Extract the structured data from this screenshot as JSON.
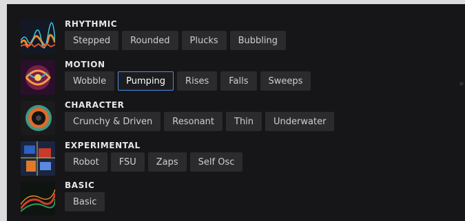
{
  "categories": [
    {
      "title": "RHYTHMIC",
      "thumb_icon": "rhythmic-waveform-thumbnail",
      "tags": [
        "Stepped",
        "Rounded",
        "Plucks",
        "Bubbling"
      ],
      "selected": null
    },
    {
      "title": "MOTION",
      "thumb_icon": "motion-swirl-thumbnail",
      "tags": [
        "Wobble",
        "Pumping",
        "Rises",
        "Falls",
        "Sweeps"
      ],
      "selected": 1
    },
    {
      "title": "CHARACTER",
      "thumb_icon": "character-speaker-thumbnail",
      "tags": [
        "Crunchy & Driven",
        "Resonant",
        "Thin",
        "Underwater"
      ],
      "selected": null
    },
    {
      "title": "EXPERIMENTAL",
      "thumb_icon": "experimental-circuit-thumbnail",
      "tags": [
        "Robot",
        "FSU",
        "Zaps",
        "Self Osc"
      ],
      "selected": null
    },
    {
      "title": "BASIC",
      "thumb_icon": "basic-waves-thumbnail",
      "tags": [
        "Basic"
      ],
      "selected": null
    }
  ],
  "colors": {
    "panel": "#161618",
    "tag_bg": "#2b2b2e",
    "selected_border": "#4a8ee6",
    "text": "#cfcfd2"
  }
}
